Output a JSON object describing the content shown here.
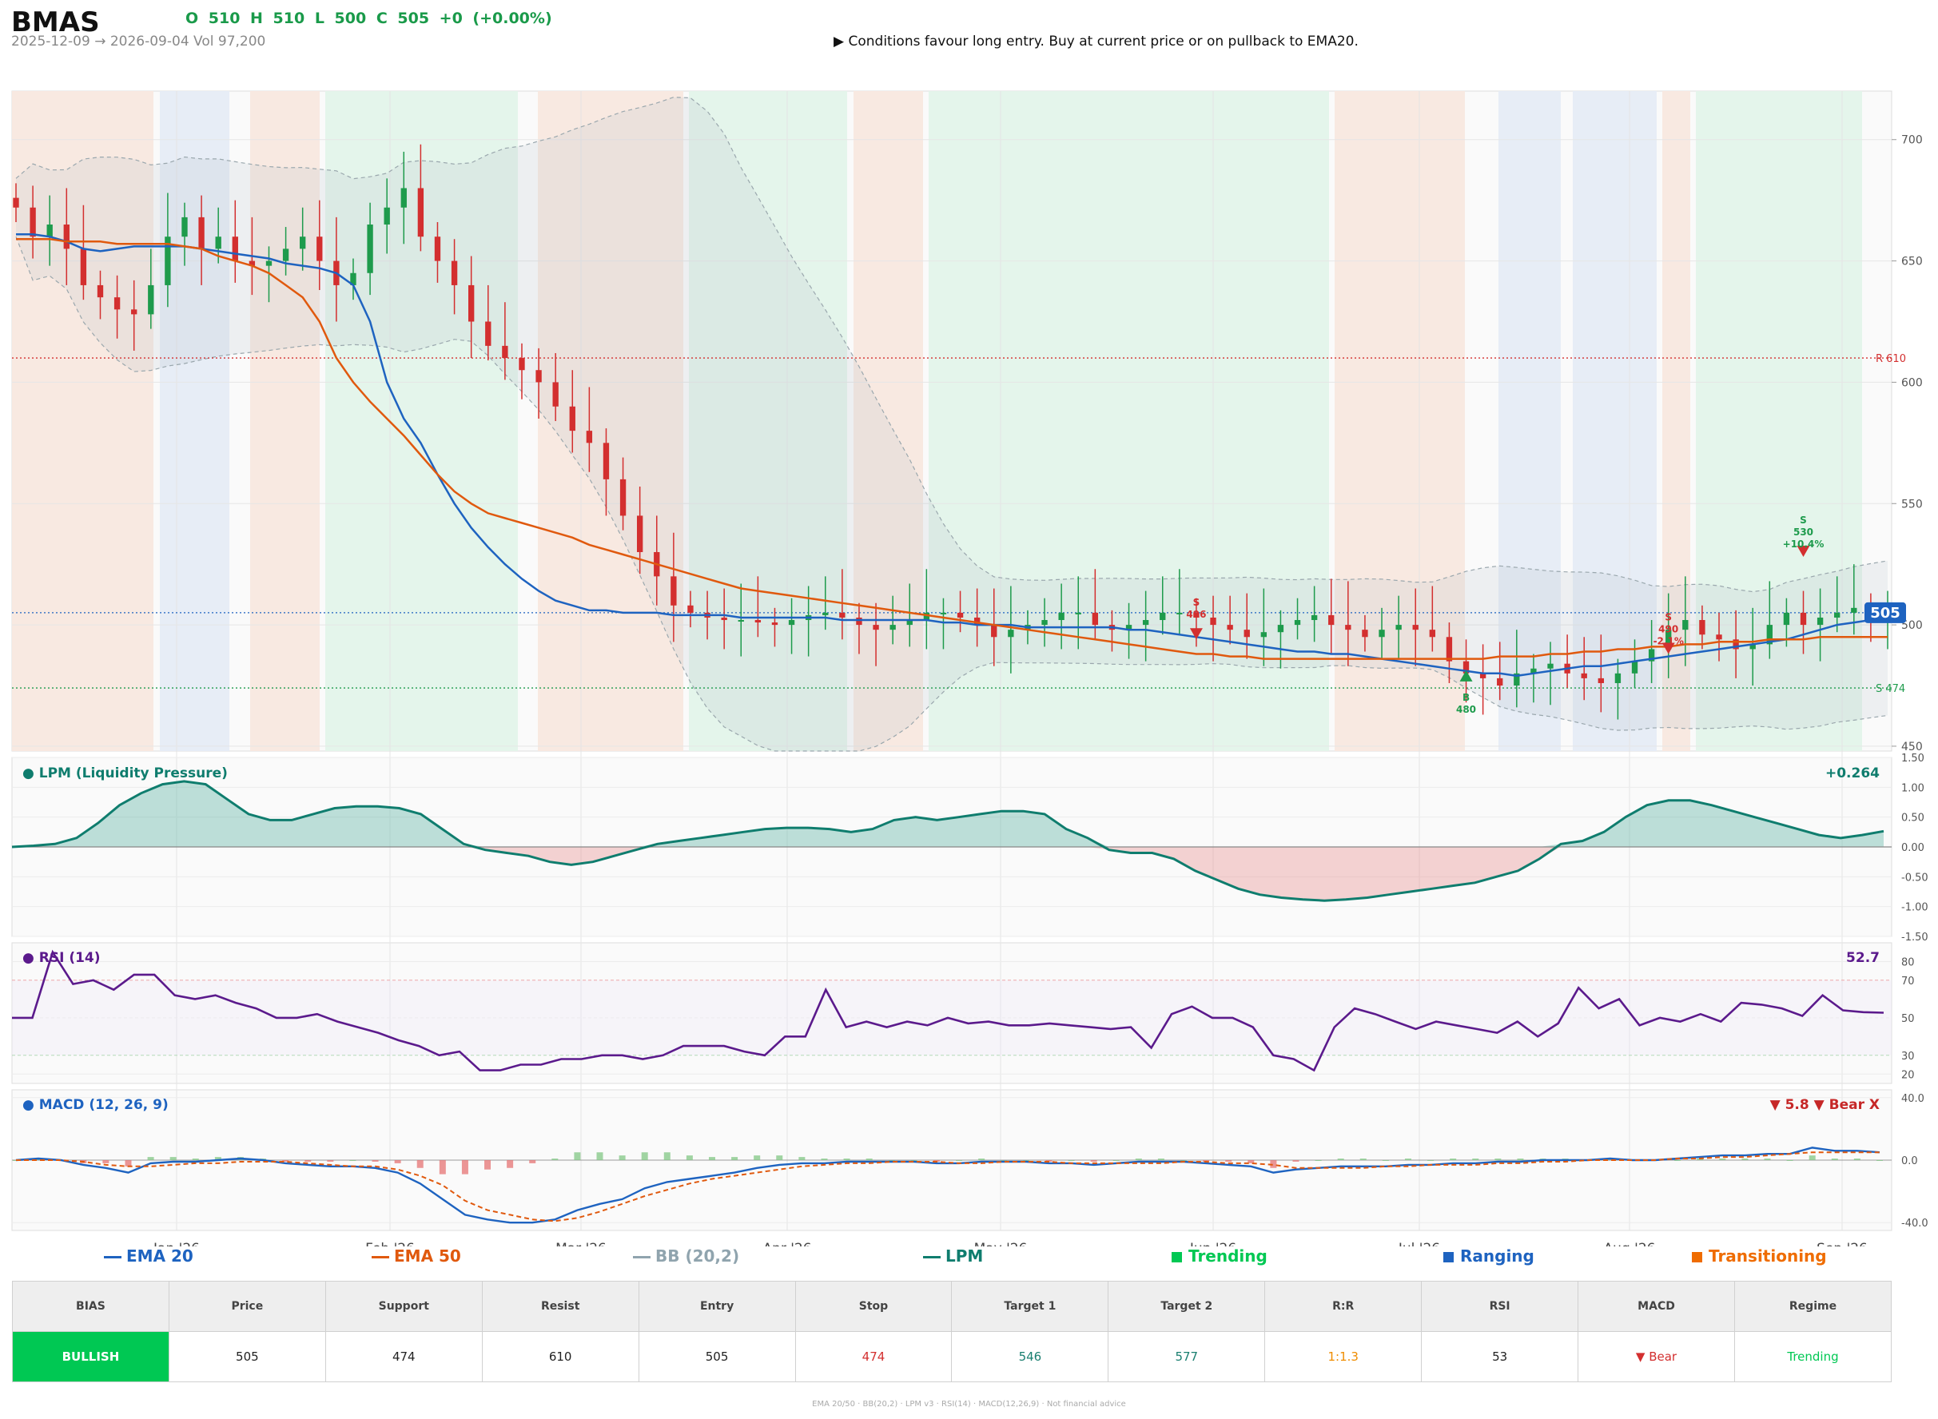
{
  "header": {
    "ticker": "BMAS",
    "ohlc": "O 510   H 510   L 500   C 505   +0  (+0.00%)",
    "range": "2025-12-09 → 2026-09-04   Vol 97,200",
    "signal": "▶  Conditions favour long entry. Buy at current price or on pullback to EMA20."
  },
  "colors": {
    "bull": "#1e9b4c",
    "bear": "#d32f2f",
    "ema20": "#1e63c0",
    "ema50": "#e0590e",
    "lpm": "#0f7d6e",
    "rsi": "#5b1a8c",
    "macd": "#1e63c0",
    "signal": "#e0590e",
    "trending": "#e3f4ea",
    "ranging": "#e6ecf5",
    "transitioning": "#f8e8df"
  },
  "chart_data": {
    "type": "candlestick",
    "x_ticks": [
      "Jan '26",
      "Feb '26",
      "Mar '26",
      "Apr '26",
      "May '26",
      "Jun '26",
      "Jul '26",
      "Aug '26",
      "Sep '26"
    ],
    "price_axis": {
      "ylim": [
        448,
        720
      ],
      "ticks": [
        "450",
        "500",
        "550",
        "600",
        "650",
        "700"
      ]
    },
    "price_series": [
      {
        "name": "close",
        "values": [
          672,
          660,
          665,
          655,
          640,
          635,
          630,
          628,
          640,
          660,
          668,
          655,
          660,
          650,
          648,
          650,
          655,
          660,
          650,
          640,
          645,
          665,
          672,
          680,
          660,
          650,
          640,
          625,
          615,
          610,
          605,
          600,
          590,
          580,
          575,
          560,
          545,
          530,
          520,
          508,
          505,
          503,
          502,
          502,
          501,
          500,
          502,
          504,
          505,
          503,
          500,
          498,
          500,
          502,
          505,
          505,
          503,
          500,
          495,
          498,
          500,
          502,
          505,
          505,
          500,
          498,
          500,
          502,
          505,
          505,
          503,
          500,
          498,
          495,
          497,
          500,
          502,
          504,
          500,
          498,
          495,
          498,
          500,
          498,
          495,
          485,
          480,
          478,
          475,
          480,
          482,
          484,
          480,
          478,
          476,
          480,
          485,
          490,
          498,
          502,
          496,
          494,
          490,
          492,
          500,
          505,
          500,
          503,
          505,
          507,
          505,
          505
        ]
      },
      {
        "name": "EMA 20",
        "values": [
          661,
          661,
          660,
          658,
          655,
          654,
          655,
          656,
          656,
          656,
          656,
          655,
          654,
          653,
          652,
          651,
          649,
          648,
          647,
          645,
          640,
          625,
          600,
          585,
          575,
          562,
          550,
          540,
          532,
          525,
          519,
          514,
          510,
          508,
          506,
          506,
          505,
          505,
          505,
          504,
          504,
          504,
          504,
          503,
          503,
          503,
          503,
          503,
          503,
          502,
          502,
          502,
          502,
          502,
          502,
          501,
          501,
          500,
          500,
          500,
          499,
          499,
          499,
          499,
          499,
          499,
          498,
          498,
          497,
          496,
          495,
          494,
          493,
          492,
          491,
          490,
          489,
          489,
          488,
          488,
          487,
          486,
          485,
          484,
          483,
          482,
          481,
          480,
          480,
          479,
          480,
          481,
          482,
          483,
          483,
          484,
          485,
          486,
          487,
          488,
          489,
          490,
          491,
          492,
          493,
          494,
          496,
          498,
          500,
          501,
          502,
          503
        ]
      },
      {
        "name": "EMA 50",
        "values": [
          659,
          659,
          659,
          658,
          658,
          658,
          657,
          657,
          657,
          657,
          656,
          655,
          652,
          650,
          648,
          645,
          640,
          635,
          625,
          610,
          600,
          592,
          585,
          578,
          570,
          562,
          555,
          550,
          546,
          544,
          542,
          540,
          538,
          536,
          533,
          531,
          529,
          527,
          525,
          523,
          521,
          519,
          517,
          515,
          514,
          513,
          512,
          511,
          510,
          509,
          508,
          507,
          506,
          505,
          504,
          503,
          502,
          501,
          500,
          499,
          498,
          497,
          496,
          495,
          494,
          493,
          492,
          491,
          490,
          489,
          488,
          488,
          487,
          487,
          486,
          486,
          486,
          486,
          486,
          486,
          486,
          486,
          486,
          486,
          486,
          486,
          486,
          486,
          487,
          487,
          487,
          488,
          488,
          489,
          489,
          490,
          490,
          491,
          491,
          492,
          492,
          493,
          493,
          493,
          494,
          494,
          494,
          495,
          495,
          495,
          495,
          495
        ]
      }
    ],
    "regimes": [
      {
        "name": "Trending",
        "color": "#e3f4ea"
      },
      {
        "name": "Ranging",
        "color": "#e6ecf5"
      },
      {
        "name": "Transitioning",
        "color": "#f8e8df"
      }
    ],
    "levels": [
      {
        "name": "R 610",
        "value": 610,
        "color": "#d32f2f"
      },
      {
        "name": "S 474",
        "value": 474,
        "color": "#1e9b4c"
      },
      {
        "name": "price",
        "value": 505,
        "color": "#1e63c0"
      }
    ],
    "price_tag": "505",
    "signals": [
      {
        "text": "S",
        "sub": "496",
        "value": 496
      },
      {
        "text": "B",
        "sub": "480",
        "value": 480
      },
      {
        "text": "S",
        "sub": "490",
        "sub2": "-2.1%",
        "value": 490
      },
      {
        "text": "S",
        "sub": "530",
        "sub2": "+10.4%",
        "value": 530
      }
    ],
    "lpm": {
      "title": "● LPM (Liquidity Pressure)",
      "value_label": "+0.264",
      "ylim": [
        -1.5,
        1.5
      ],
      "ticks": [
        "1.50",
        "1.00",
        "0.50",
        "0.00",
        "-0.50",
        "-1.00",
        "-1.50"
      ],
      "values": [
        0.0,
        0.02,
        0.05,
        0.15,
        0.4,
        0.7,
        0.9,
        1.05,
        1.1,
        1.05,
        0.8,
        0.55,
        0.45,
        0.45,
        0.55,
        0.65,
        0.68,
        0.68,
        0.65,
        0.55,
        0.3,
        0.05,
        -0.05,
        -0.1,
        -0.15,
        -0.25,
        -0.3,
        -0.25,
        -0.15,
        -0.05,
        0.05,
        0.1,
        0.15,
        0.2,
        0.25,
        0.3,
        0.32,
        0.32,
        0.3,
        0.25,
        0.3,
        0.45,
        0.5,
        0.45,
        0.5,
        0.55,
        0.6,
        0.6,
        0.55,
        0.3,
        0.15,
        -0.05,
        -0.1,
        -0.1,
        -0.2,
        -0.4,
        -0.55,
        -0.7,
        -0.8,
        -0.85,
        -0.88,
        -0.9,
        -0.88,
        -0.85,
        -0.8,
        -0.75,
        -0.7,
        -0.65,
        -0.6,
        -0.5,
        -0.4,
        -0.2,
        0.05,
        0.1,
        0.25,
        0.5,
        0.7,
        0.78,
        0.78,
        0.7,
        0.6,
        0.5,
        0.4,
        0.3,
        0.2,
        0.15,
        0.2,
        0.264
      ]
    },
    "rsi": {
      "title": "● RSI (14)",
      "value_label": "52.7",
      "ylim": [
        15,
        90
      ],
      "ticks": [
        "80",
        "70",
        "50",
        "30",
        "20"
      ],
      "values": [
        50,
        50,
        85,
        68,
        70,
        65,
        73,
        73,
        62,
        60,
        62,
        58,
        55,
        50,
        50,
        52,
        48,
        45,
        42,
        38,
        35,
        30,
        32,
        22,
        22,
        25,
        25,
        28,
        28,
        30,
        30,
        28,
        30,
        35,
        35,
        35,
        32,
        30,
        40,
        40,
        65,
        45,
        48,
        45,
        48,
        46,
        50,
        47,
        48,
        46,
        46,
        47,
        46,
        45,
        44,
        45,
        34,
        52,
        56,
        50,
        50,
        45,
        30,
        28,
        22,
        45,
        55,
        52,
        48,
        44,
        48,
        46,
        44,
        42,
        48,
        40,
        47,
        66,
        55,
        60,
        46,
        50,
        48,
        52,
        48,
        58,
        57,
        55,
        51,
        62,
        54,
        53,
        52.7
      ]
    },
    "macd": {
      "title": "● MACD (12, 26, 9)",
      "value_label": "▼ 5.8 ▼ Bear X",
      "ylim": [
        -45,
        45
      ],
      "ticks": [
        "40.0",
        "0.0",
        "-40.0"
      ],
      "macd": [
        0,
        1,
        0,
        -3,
        -5,
        -8,
        -2,
        -1,
        -1,
        0,
        1,
        0,
        -2,
        -3,
        -4,
        -4,
        -5,
        -8,
        -15,
        -25,
        -35,
        -38,
        -40,
        -40,
        -38,
        -32,
        -28,
        -25,
        -18,
        -14,
        -12,
        -10,
        -8,
        -5,
        -3,
        -2,
        -2,
        -1,
        -1,
        -1,
        -1,
        -2,
        -2,
        -1,
        -1,
        -1,
        -2,
        -2,
        -3,
        -2,
        -1,
        -1,
        -1,
        -2,
        -3,
        -4,
        -8,
        -6,
        -5,
        -4,
        -4,
        -4,
        -3,
        -3,
        -2,
        -2,
        -1,
        -1,
        0,
        0,
        0,
        1,
        0,
        0,
        1,
        2,
        3,
        3,
        4,
        4,
        8,
        6,
        6,
        5
      ],
      "signal": [
        0,
        0,
        0,
        -1,
        -3,
        -4,
        -4,
        -3,
        -2,
        -2,
        -1,
        -1,
        -1,
        -2,
        -3,
        -4,
        -4,
        -6,
        -10,
        -16,
        -26,
        -32,
        -35,
        -38,
        -39,
        -37,
        -33,
        -28,
        -23,
        -19,
        -15,
        -12,
        -10,
        -8,
        -6,
        -4,
        -3,
        -2,
        -2,
        -1,
        -1,
        -1,
        -2,
        -2,
        -1,
        -1,
        -1,
        -2,
        -2,
        -2,
        -2,
        -2,
        -1,
        -1,
        -2,
        -2,
        -3,
        -5,
        -5,
        -5,
        -5,
        -4,
        -4,
        -3,
        -3,
        -3,
        -2,
        -2,
        -1,
        -1,
        0,
        0,
        0,
        0,
        1,
        1,
        2,
        2,
        3,
        4,
        5,
        5,
        5,
        5
      ],
      "hist": [
        0,
        1,
        0,
        -2,
        -2,
        -4,
        2,
        2,
        1,
        2,
        2,
        1,
        -1,
        -1,
        -1,
        0,
        -1,
        -2,
        -5,
        -9,
        -9,
        -6,
        -5,
        -2,
        1,
        5,
        5,
        3,
        5,
        5,
        3,
        2,
        2,
        3,
        3,
        2,
        1,
        1,
        1,
        0,
        0,
        -1,
        0,
        1,
        0,
        0,
        -1,
        0,
        -1,
        0,
        1,
        1,
        0,
        -1,
        -1,
        -2,
        -5,
        -1,
        0,
        1,
        1,
        0,
        1,
        0,
        1,
        1,
        1,
        1,
        1,
        1,
        0,
        1,
        0,
        0,
        0,
        1,
        1,
        1,
        1,
        0,
        3,
        1,
        1,
        0
      ]
    },
    "legend": [
      {
        "label": "EMA 20",
        "type": "line",
        "color": "#1e63c0"
      },
      {
        "label": "EMA 50",
        "type": "line",
        "color": "#e0590e"
      },
      {
        "label": "BB (20,2)",
        "type": "line",
        "color": "#90a4ae"
      },
      {
        "label": "LPM",
        "type": "line",
        "color": "#0f7d6e"
      },
      {
        "label": "Trending",
        "type": "square",
        "color": "#00c853"
      },
      {
        "label": "Ranging",
        "type": "square",
        "color": "#1e63c0"
      },
      {
        "label": "Transitioning",
        "type": "square",
        "color": "#ef6c00"
      }
    ]
  },
  "table": {
    "headers": [
      "BIAS",
      "Price",
      "Support",
      "Resist",
      "Entry",
      "Stop",
      "Target 1",
      "Target 2",
      "R:R",
      "RSI",
      "MACD",
      "Regime"
    ],
    "values": [
      "BULLISH",
      "505",
      "474",
      "610",
      "505",
      "474",
      "546",
      "577",
      "1:1.3",
      "53",
      "▼ Bear",
      "Trending"
    ],
    "colors": [
      "#ffffff",
      "#222222",
      "#222222",
      "#222222",
      "#222222",
      "#d32f2f",
      "#1a7f70",
      "#1a7f70",
      "#ef8c00",
      "#222222",
      "#d32f2f",
      "#00c853"
    ]
  },
  "footer": "EMA 20/50  ·  BB(20,2)  ·  LPM v3  ·  RSI(14)  ·  MACD(12,26,9)  ·  Not financial advice"
}
